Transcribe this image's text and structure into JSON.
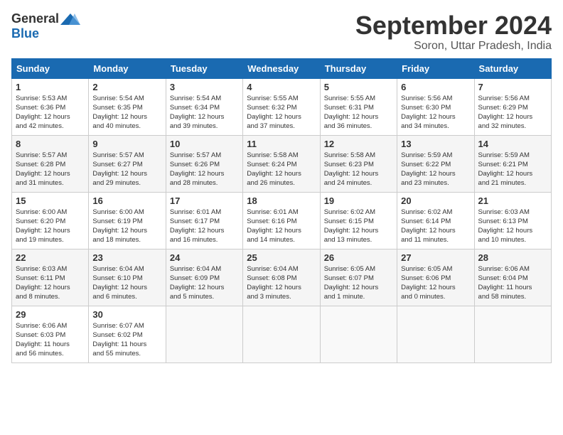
{
  "logo": {
    "general": "General",
    "blue": "Blue"
  },
  "title": {
    "month": "September 2024",
    "location": "Soron, Uttar Pradesh, India"
  },
  "weekdays": [
    "Sunday",
    "Monday",
    "Tuesday",
    "Wednesday",
    "Thursday",
    "Friday",
    "Saturday"
  ],
  "weeks": [
    [
      {
        "day": 1,
        "lines": [
          "Sunrise: 5:53 AM",
          "Sunset: 6:36 PM",
          "Daylight: 12 hours",
          "and 42 minutes."
        ]
      },
      {
        "day": 2,
        "lines": [
          "Sunrise: 5:54 AM",
          "Sunset: 6:35 PM",
          "Daylight: 12 hours",
          "and 40 minutes."
        ]
      },
      {
        "day": 3,
        "lines": [
          "Sunrise: 5:54 AM",
          "Sunset: 6:34 PM",
          "Daylight: 12 hours",
          "and 39 minutes."
        ]
      },
      {
        "day": 4,
        "lines": [
          "Sunrise: 5:55 AM",
          "Sunset: 6:32 PM",
          "Daylight: 12 hours",
          "and 37 minutes."
        ]
      },
      {
        "day": 5,
        "lines": [
          "Sunrise: 5:55 AM",
          "Sunset: 6:31 PM",
          "Daylight: 12 hours",
          "and 36 minutes."
        ]
      },
      {
        "day": 6,
        "lines": [
          "Sunrise: 5:56 AM",
          "Sunset: 6:30 PM",
          "Daylight: 12 hours",
          "and 34 minutes."
        ]
      },
      {
        "day": 7,
        "lines": [
          "Sunrise: 5:56 AM",
          "Sunset: 6:29 PM",
          "Daylight: 12 hours",
          "and 32 minutes."
        ]
      }
    ],
    [
      {
        "day": 8,
        "lines": [
          "Sunrise: 5:57 AM",
          "Sunset: 6:28 PM",
          "Daylight: 12 hours",
          "and 31 minutes."
        ]
      },
      {
        "day": 9,
        "lines": [
          "Sunrise: 5:57 AM",
          "Sunset: 6:27 PM",
          "Daylight: 12 hours",
          "and 29 minutes."
        ]
      },
      {
        "day": 10,
        "lines": [
          "Sunrise: 5:57 AM",
          "Sunset: 6:26 PM",
          "Daylight: 12 hours",
          "and 28 minutes."
        ]
      },
      {
        "day": 11,
        "lines": [
          "Sunrise: 5:58 AM",
          "Sunset: 6:24 PM",
          "Daylight: 12 hours",
          "and 26 minutes."
        ]
      },
      {
        "day": 12,
        "lines": [
          "Sunrise: 5:58 AM",
          "Sunset: 6:23 PM",
          "Daylight: 12 hours",
          "and 24 minutes."
        ]
      },
      {
        "day": 13,
        "lines": [
          "Sunrise: 5:59 AM",
          "Sunset: 6:22 PM",
          "Daylight: 12 hours",
          "and 23 minutes."
        ]
      },
      {
        "day": 14,
        "lines": [
          "Sunrise: 5:59 AM",
          "Sunset: 6:21 PM",
          "Daylight: 12 hours",
          "and 21 minutes."
        ]
      }
    ],
    [
      {
        "day": 15,
        "lines": [
          "Sunrise: 6:00 AM",
          "Sunset: 6:20 PM",
          "Daylight: 12 hours",
          "and 19 minutes."
        ]
      },
      {
        "day": 16,
        "lines": [
          "Sunrise: 6:00 AM",
          "Sunset: 6:19 PM",
          "Daylight: 12 hours",
          "and 18 minutes."
        ]
      },
      {
        "day": 17,
        "lines": [
          "Sunrise: 6:01 AM",
          "Sunset: 6:17 PM",
          "Daylight: 12 hours",
          "and 16 minutes."
        ]
      },
      {
        "day": 18,
        "lines": [
          "Sunrise: 6:01 AM",
          "Sunset: 6:16 PM",
          "Daylight: 12 hours",
          "and 14 minutes."
        ]
      },
      {
        "day": 19,
        "lines": [
          "Sunrise: 6:02 AM",
          "Sunset: 6:15 PM",
          "Daylight: 12 hours",
          "and 13 minutes."
        ]
      },
      {
        "day": 20,
        "lines": [
          "Sunrise: 6:02 AM",
          "Sunset: 6:14 PM",
          "Daylight: 12 hours",
          "and 11 minutes."
        ]
      },
      {
        "day": 21,
        "lines": [
          "Sunrise: 6:03 AM",
          "Sunset: 6:13 PM",
          "Daylight: 12 hours",
          "and 10 minutes."
        ]
      }
    ],
    [
      {
        "day": 22,
        "lines": [
          "Sunrise: 6:03 AM",
          "Sunset: 6:11 PM",
          "Daylight: 12 hours",
          "and 8 minutes."
        ]
      },
      {
        "day": 23,
        "lines": [
          "Sunrise: 6:04 AM",
          "Sunset: 6:10 PM",
          "Daylight: 12 hours",
          "and 6 minutes."
        ]
      },
      {
        "day": 24,
        "lines": [
          "Sunrise: 6:04 AM",
          "Sunset: 6:09 PM",
          "Daylight: 12 hours",
          "and 5 minutes."
        ]
      },
      {
        "day": 25,
        "lines": [
          "Sunrise: 6:04 AM",
          "Sunset: 6:08 PM",
          "Daylight: 12 hours",
          "and 3 minutes."
        ]
      },
      {
        "day": 26,
        "lines": [
          "Sunrise: 6:05 AM",
          "Sunset: 6:07 PM",
          "Daylight: 12 hours",
          "and 1 minute."
        ]
      },
      {
        "day": 27,
        "lines": [
          "Sunrise: 6:05 AM",
          "Sunset: 6:06 PM",
          "Daylight: 12 hours",
          "and 0 minutes."
        ]
      },
      {
        "day": 28,
        "lines": [
          "Sunrise: 6:06 AM",
          "Sunset: 6:04 PM",
          "Daylight: 11 hours",
          "and 58 minutes."
        ]
      }
    ],
    [
      {
        "day": 29,
        "lines": [
          "Sunrise: 6:06 AM",
          "Sunset: 6:03 PM",
          "Daylight: 11 hours",
          "and 56 minutes."
        ]
      },
      {
        "day": 30,
        "lines": [
          "Sunrise: 6:07 AM",
          "Sunset: 6:02 PM",
          "Daylight: 11 hours",
          "and 55 minutes."
        ]
      },
      null,
      null,
      null,
      null,
      null
    ]
  ]
}
